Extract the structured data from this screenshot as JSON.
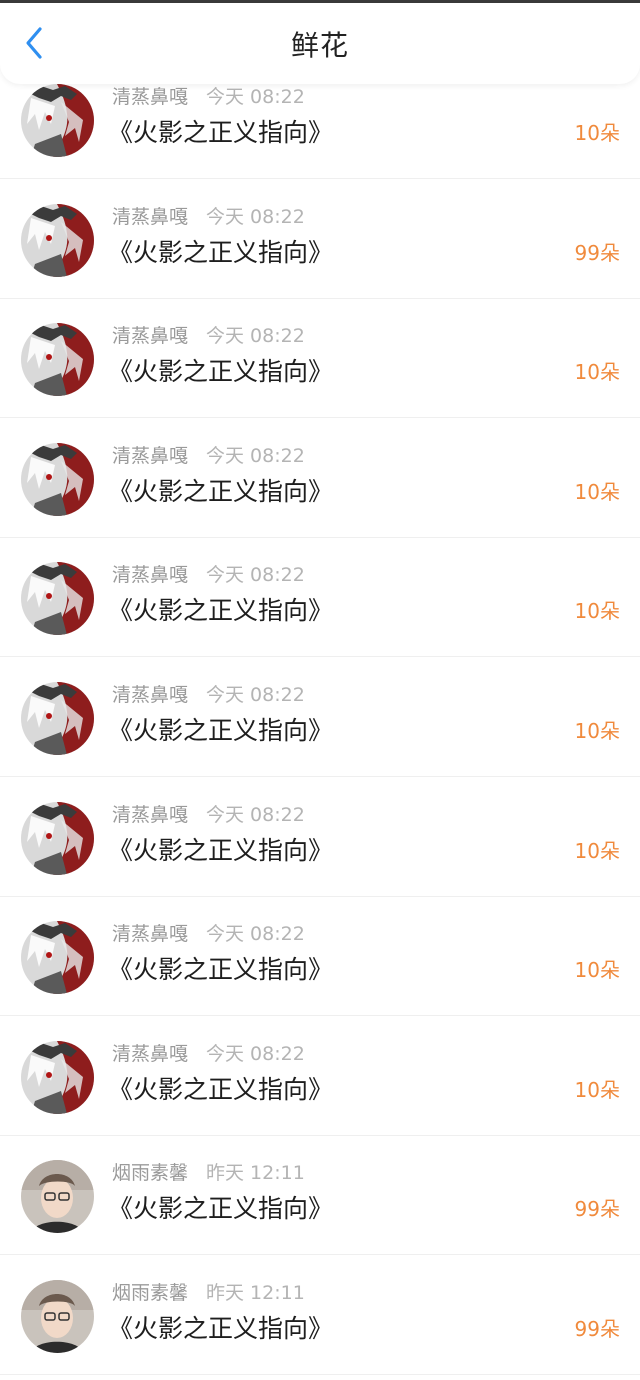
{
  "header": {
    "title": "鲜花",
    "back_icon": "chevron-left-icon",
    "accent_color": "#2f8ff0"
  },
  "amount_color": "#f08a3c",
  "records": [
    {
      "user": "清蒸鼻嘎",
      "time": "今天 08:22",
      "book": "《火影之正义指向》",
      "amount": "10朵",
      "avatar": "anime"
    },
    {
      "user": "清蒸鼻嘎",
      "time": "今天 08:22",
      "book": "《火影之正义指向》",
      "amount": "99朵",
      "avatar": "anime"
    },
    {
      "user": "清蒸鼻嘎",
      "time": "今天 08:22",
      "book": "《火影之正义指向》",
      "amount": "10朵",
      "avatar": "anime"
    },
    {
      "user": "清蒸鼻嘎",
      "time": "今天 08:22",
      "book": "《火影之正义指向》",
      "amount": "10朵",
      "avatar": "anime"
    },
    {
      "user": "清蒸鼻嘎",
      "time": "今天 08:22",
      "book": "《火影之正义指向》",
      "amount": "10朵",
      "avatar": "anime"
    },
    {
      "user": "清蒸鼻嘎",
      "time": "今天 08:22",
      "book": "《火影之正义指向》",
      "amount": "10朵",
      "avatar": "anime"
    },
    {
      "user": "清蒸鼻嘎",
      "time": "今天 08:22",
      "book": "《火影之正义指向》",
      "amount": "10朵",
      "avatar": "anime"
    },
    {
      "user": "清蒸鼻嘎",
      "time": "今天 08:22",
      "book": "《火影之正义指向》",
      "amount": "10朵",
      "avatar": "anime"
    },
    {
      "user": "清蒸鼻嘎",
      "time": "今天 08:22",
      "book": "《火影之正义指向》",
      "amount": "10朵",
      "avatar": "anime"
    },
    {
      "user": "烟雨素馨",
      "time": "昨天 12:11",
      "book": "《火影之正义指向》",
      "amount": "99朵",
      "avatar": "photo"
    },
    {
      "user": "烟雨素馨",
      "time": "昨天 12:11",
      "book": "《火影之正义指向》",
      "amount": "99朵",
      "avatar": "photo"
    }
  ]
}
